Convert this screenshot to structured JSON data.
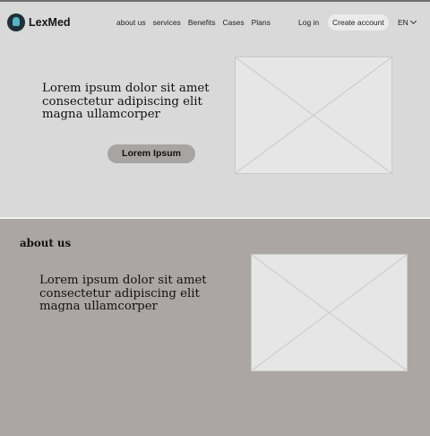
{
  "header": {
    "brand": "LexMed",
    "nav": [
      "about us",
      "services",
      "Benefits",
      "Cases",
      "Plans"
    ],
    "login": "Log in",
    "create_account": "Create account",
    "language": "EN"
  },
  "hero": {
    "text": "Lorem ipsum dolor sit amet consectetur adipiscing  elit magna ullamcorper",
    "button": "Lorem Ipsum"
  },
  "about": {
    "title": "about us",
    "text": "Lorem ipsum dolor sit amet consectetur adipiscing  elit magna ullamcorper"
  },
  "colors": {
    "hero_bg": "#d9d9d9",
    "about_bg": "#aba6a4",
    "button_bg": "#a8a4a2",
    "logo_accent": "#57b4c6"
  }
}
